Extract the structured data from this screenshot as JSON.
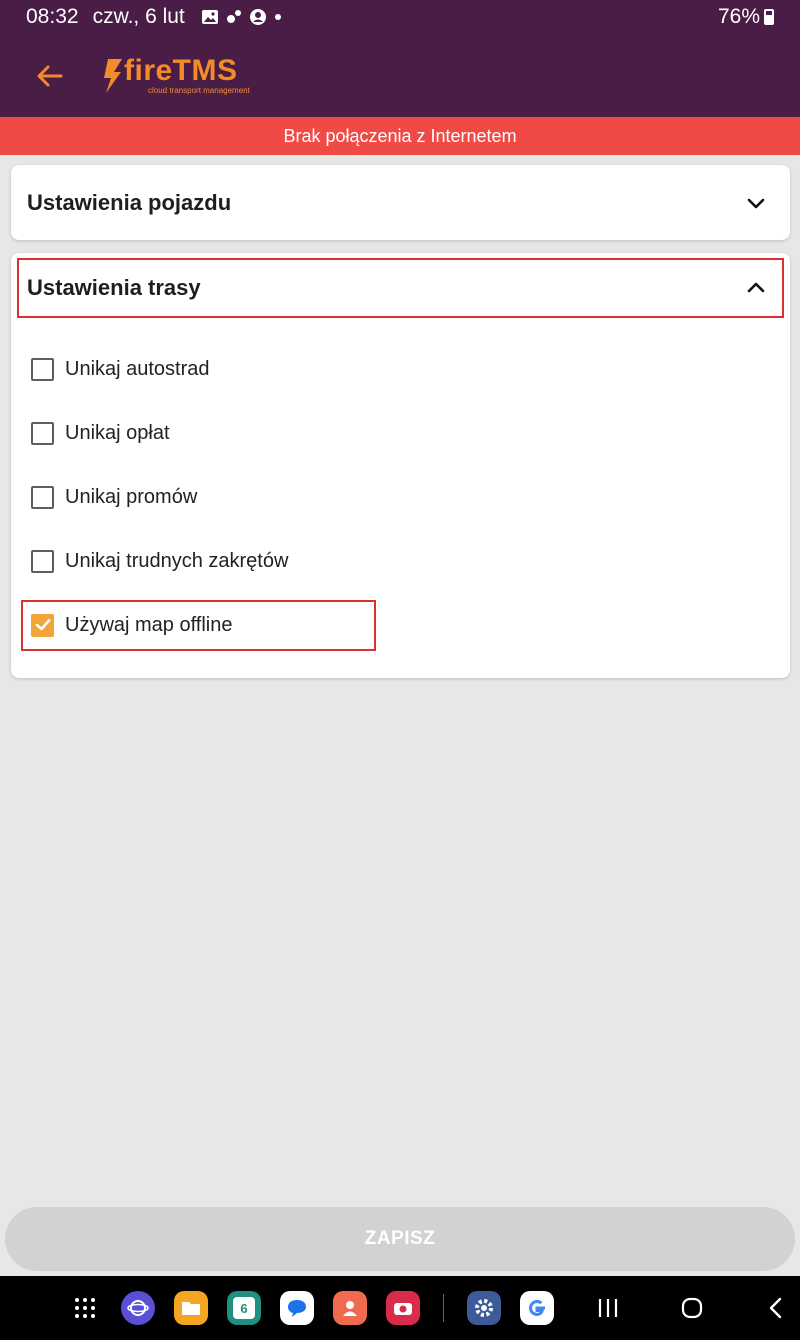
{
  "status_bar": {
    "time": "08:32",
    "date": "czw., 6 lut",
    "battery": "76%"
  },
  "app_bar": {
    "logo_word": "fireTMS",
    "logo_tagline": "cloud transport management"
  },
  "banner": {
    "text": "Brak połączenia z Internetem"
  },
  "sections": {
    "vehicle": {
      "title": "Ustawienia pojazdu",
      "expanded": false
    },
    "route": {
      "title": "Ustawienia trasy",
      "expanded": true,
      "options": [
        {
          "label": "Unikaj autostrad",
          "checked": false
        },
        {
          "label": "Unikaj opłat",
          "checked": false
        },
        {
          "label": "Unikaj promów",
          "checked": false
        },
        {
          "label": "Unikaj trudnych zakrętów",
          "checked": false
        },
        {
          "label": "Używaj map offline",
          "checked": true
        }
      ]
    }
  },
  "save_button": {
    "label": "ZAPISZ"
  },
  "taskbar": {
    "calendar_day": "6"
  },
  "colors": {
    "header_bg": "#4a1d47",
    "accent_orange": "#f28c28",
    "banner_red": "#f04a46",
    "highlight_red": "#d9312d",
    "checkbox_checked": "#f2a33a"
  }
}
